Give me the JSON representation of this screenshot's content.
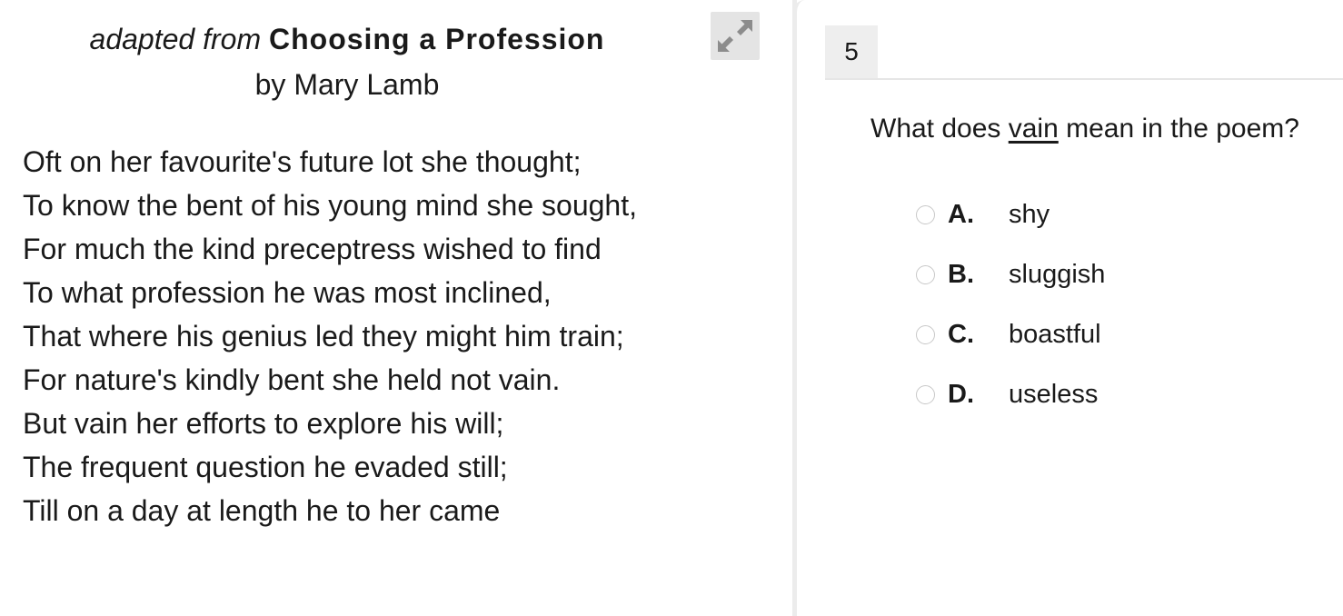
{
  "passage": {
    "title_prefix": "adapted from",
    "title": "Choosing a Profession",
    "author": "by Mary Lamb",
    "lines": [
      "Oft on her favourite's future lot she thought;",
      "To know the bent of his young mind she sought,",
      "For much the kind preceptress wished to find",
      "To what profession he was most inclined,",
      "That where his genius led they might him train;",
      "For nature's kindly bent she held not vain.",
      "But vain her efforts to explore his will;",
      "The frequent question he evaded still;",
      "Till on a day at length he to her came"
    ],
    "expand_icon": "expand-arrows-icon"
  },
  "question": {
    "number": "5",
    "stem_before": "What does ",
    "stem_word": "vain",
    "stem_after": " mean in the poem?",
    "choices": [
      {
        "letter": "A.",
        "text": "shy"
      },
      {
        "letter": "B.",
        "text": "sluggish"
      },
      {
        "letter": "C.",
        "text": "boastful"
      },
      {
        "letter": "D.",
        "text": "useless"
      }
    ]
  },
  "colors": {
    "text": "#1a1a1a",
    "expand_button_bg": "#e4e4e4",
    "expand_icon": "#8c8c8c",
    "divider": "#ececec",
    "question_number_bg": "#eeeeee",
    "radio_border": "#c8c8c8"
  }
}
